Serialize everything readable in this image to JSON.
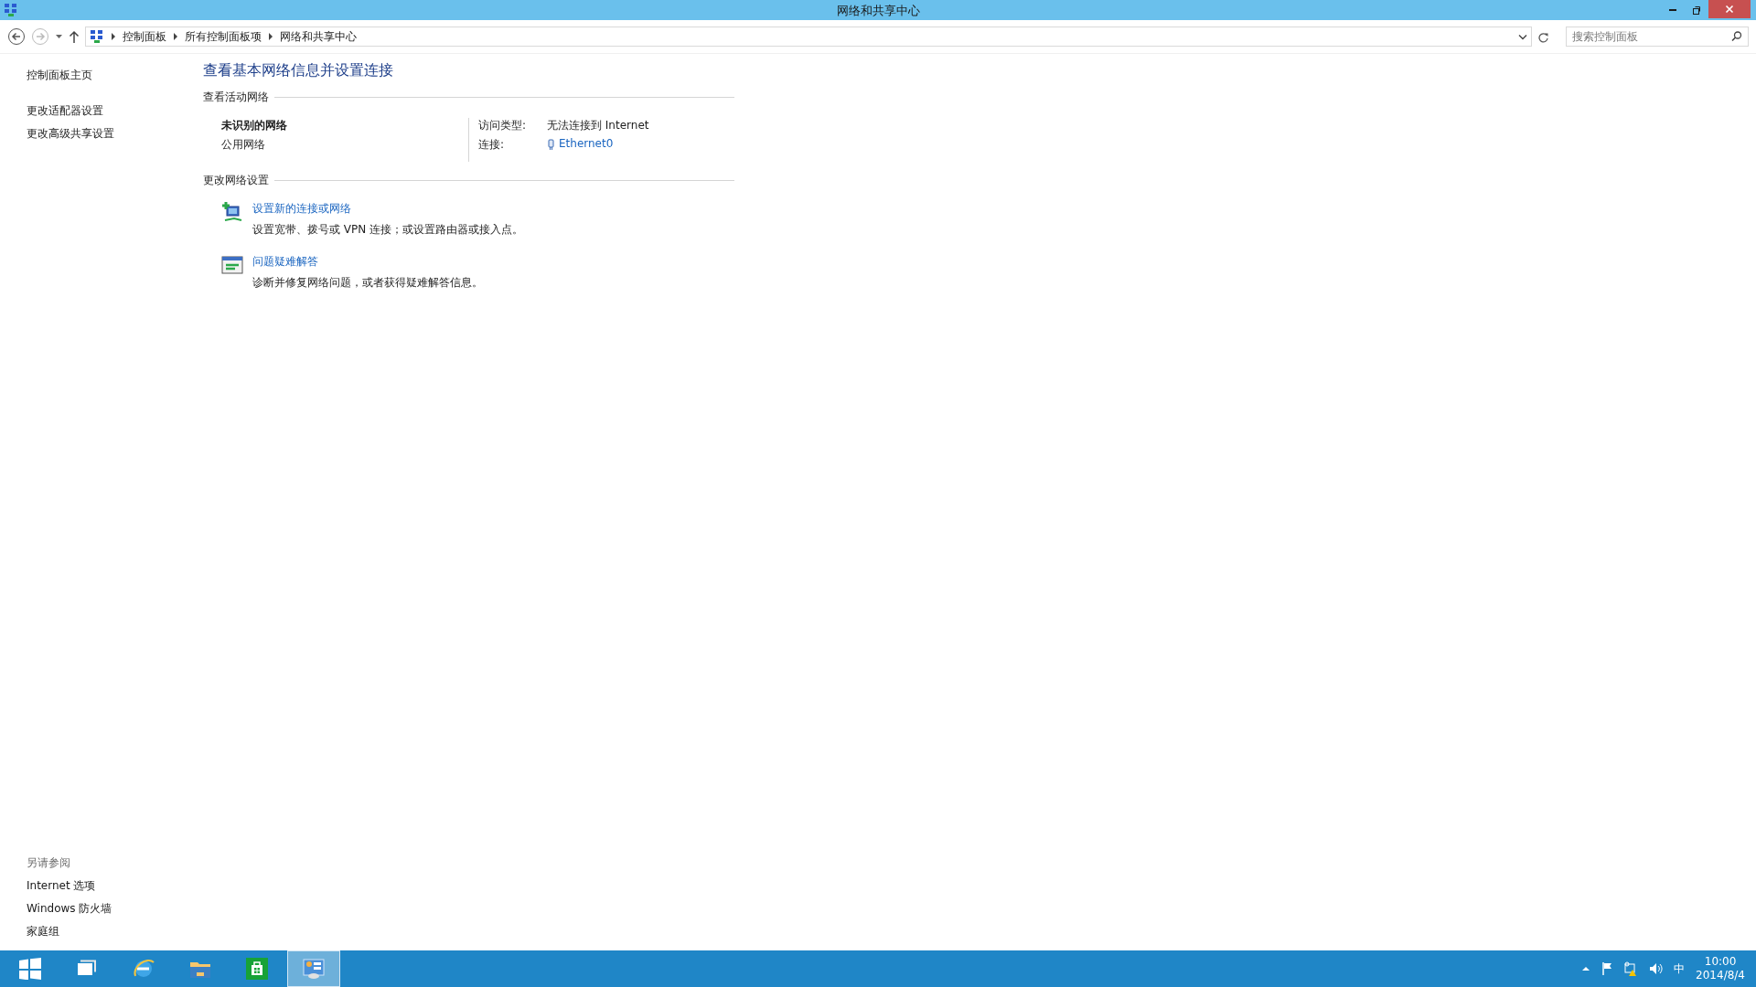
{
  "window": {
    "title": "网络和共享中心"
  },
  "address_bar": {
    "breadcrumbs": [
      "控制面板",
      "所有控制面板项",
      "网络和共享中心"
    ]
  },
  "search": {
    "placeholder": "搜索控制面板"
  },
  "sidebar": {
    "links": [
      "控制面板主页",
      "更改适配器设置",
      "更改高级共享设置"
    ],
    "see_also": {
      "heading": "另请参阅",
      "links": [
        "Internet 选项",
        "Windows 防火墙",
        "家庭组"
      ]
    }
  },
  "main": {
    "heading": "查看基本网络信息并设置连接",
    "active_networks": {
      "heading": "查看活动网络",
      "network": {
        "name": "未识别的网络",
        "category": "公用网络",
        "properties": [
          {
            "label": "访问类型:",
            "value": "无法连接到 Internet",
            "kind": "text"
          },
          {
            "label": "连接:",
            "value": "Ethernet0",
            "kind": "link"
          }
        ]
      }
    },
    "change_settings": {
      "heading": "更改网络设置",
      "tasks": [
        {
          "title": "设置新的连接或网络",
          "description": "设置宽带、拨号或 VPN 连接；或设置路由器或接入点。",
          "kind": "new-connection"
        },
        {
          "title": "问题疑难解答",
          "description": "诊断并修复网络问题，或者获得疑难解答信息。",
          "kind": "troubleshoot"
        }
      ]
    }
  },
  "taskbar": {
    "apps": [
      {
        "kind": "start",
        "selected": false
      },
      {
        "kind": "task-view",
        "selected": false
      },
      {
        "kind": "browser",
        "selected": false
      },
      {
        "kind": "folder",
        "selected": false
      },
      {
        "kind": "store",
        "selected": false
      },
      {
        "kind": "control-panel",
        "selected": true
      }
    ],
    "tray": {
      "ime": "中",
      "time": "10:00",
      "date": "2014/8/4"
    }
  }
}
